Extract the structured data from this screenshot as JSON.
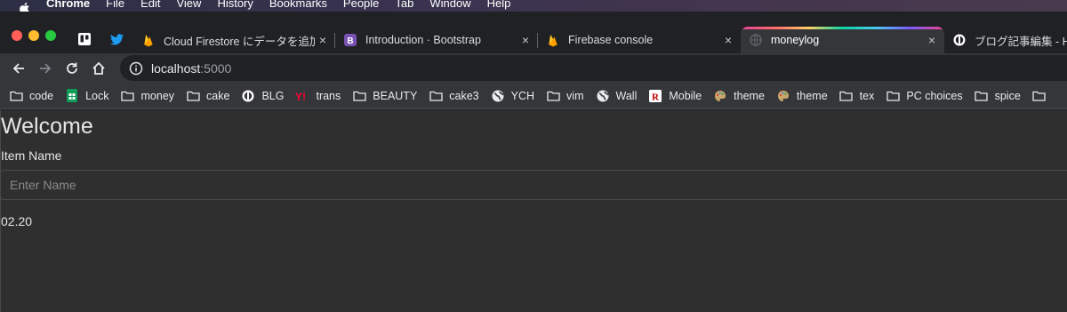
{
  "menubar": {
    "app": "Chrome",
    "items": [
      "File",
      "Edit",
      "View",
      "History",
      "Bookmarks",
      "People",
      "Tab",
      "Window",
      "Help"
    ]
  },
  "tabs": [
    {
      "title": "Cloud Firestore にデータを追加す",
      "icon": "firebase-icon",
      "active": false
    },
    {
      "title": "Introduction · Bootstrap",
      "icon": "bootstrap-icon",
      "active": false
    },
    {
      "title": "Firebase console",
      "icon": "firebase-icon",
      "active": false
    },
    {
      "title": "moneylog",
      "icon": "globe-icon",
      "active": true
    },
    {
      "title": "ブログ記事編集 - Hat",
      "icon": "hatena-icon",
      "active": false
    }
  ],
  "pinned_tabs": [
    "trello-icon",
    "twitter-icon"
  ],
  "tab_close": "×",
  "address": {
    "host": "localhost",
    "port": ":5000"
  },
  "bookmarks": [
    {
      "label": "code",
      "icon": "folder-icon"
    },
    {
      "label": "Lock",
      "icon": "sheets-icon"
    },
    {
      "label": "money",
      "icon": "folder-icon"
    },
    {
      "label": "cake",
      "icon": "folder-icon"
    },
    {
      "label": "BLG",
      "icon": "hatena-icon"
    },
    {
      "label": "trans",
      "icon": "yahoo-icon"
    },
    {
      "label": "BEAUTY",
      "icon": "folder-icon"
    },
    {
      "label": "cake3",
      "icon": "folder-icon"
    },
    {
      "label": "YCH",
      "icon": "globe-icon"
    },
    {
      "label": "vim",
      "icon": "folder-icon"
    },
    {
      "label": "Wall",
      "icon": "globe-icon"
    },
    {
      "label": "Mobile",
      "icon": "rakuten-icon"
    },
    {
      "label": "theme",
      "icon": "palette-icon"
    },
    {
      "label": "theme",
      "icon": "palette-icon"
    },
    {
      "label": "tex",
      "icon": "folder-icon"
    },
    {
      "label": "PC choices",
      "icon": "folder-icon"
    },
    {
      "label": "spice",
      "icon": "folder-icon"
    }
  ],
  "page": {
    "heading": "Welcome",
    "item_label": "Item Name",
    "input_placeholder": "Enter Name",
    "input_value": "",
    "date": "02.20"
  },
  "colors": {
    "page_bg": "#2f2f2f",
    "chrome_bg": "#202124",
    "toolbar_bg": "#35363a",
    "red": "#ff5f57",
    "yellow": "#febc2e",
    "green": "#28c840"
  }
}
